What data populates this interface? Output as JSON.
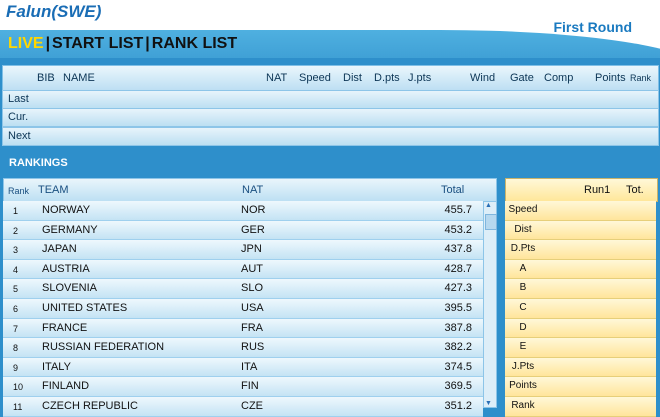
{
  "header": {
    "venue": "Falun(SWE)",
    "round": "First Round",
    "tabs": [
      {
        "label": "LIVE",
        "active": true
      },
      {
        "label": "START LIST",
        "active": false
      },
      {
        "label": "RANK LIST",
        "active": false
      }
    ]
  },
  "live": {
    "columns": [
      "BIB",
      "NAME",
      "NAT",
      "Speed",
      "Dist",
      "D.pts",
      "J.pts",
      "Wind",
      "Gate",
      "Comp",
      "Points",
      "Rank"
    ],
    "rows": [
      "Last",
      "Cur.",
      "Next"
    ]
  },
  "rankings": {
    "title": "RANKINGS",
    "columns": {
      "rank": "Rank",
      "team": "TEAM",
      "nat": "NAT",
      "total": "Total"
    },
    "rows": [
      {
        "rank": "1",
        "team": "NORWAY",
        "nat": "NOR",
        "total": "455.7"
      },
      {
        "rank": "2",
        "team": "GERMANY",
        "nat": "GER",
        "total": "453.2"
      },
      {
        "rank": "3",
        "team": "JAPAN",
        "nat": "JPN",
        "total": "437.8"
      },
      {
        "rank": "4",
        "team": "AUSTRIA",
        "nat": "AUT",
        "total": "428.7"
      },
      {
        "rank": "5",
        "team": "SLOVENIA",
        "nat": "SLO",
        "total": "427.3"
      },
      {
        "rank": "6",
        "team": "UNITED STATES",
        "nat": "USA",
        "total": "395.5"
      },
      {
        "rank": "7",
        "team": "FRANCE",
        "nat": "FRA",
        "total": "387.8"
      },
      {
        "rank": "8",
        "team": "RUSSIAN FEDERATION",
        "nat": "RUS",
        "total": "382.2"
      },
      {
        "rank": "9",
        "team": "ITALY",
        "nat": "ITA",
        "total": "374.5"
      },
      {
        "rank": "10",
        "team": "FINLAND",
        "nat": "FIN",
        "total": "369.5"
      },
      {
        "rank": "11",
        "team": "CZECH REPUBLIC",
        "nat": "CZE",
        "total": "351.2"
      }
    ]
  },
  "details": {
    "columns": [
      "Run1",
      "Tot."
    ],
    "rows": [
      "Speed",
      "Dist",
      "D.Pts",
      "A",
      "B",
      "C",
      "D",
      "E",
      "J.Pts",
      "Points",
      "Rank"
    ]
  },
  "icons": {
    "scroll_up": "triangle-up-icon",
    "scroll_down": "triangle-down-icon"
  },
  "colors": {
    "background": "#2e8fcb",
    "tab_active": "#ffd700",
    "detail_panel": "#ffe59b"
  }
}
